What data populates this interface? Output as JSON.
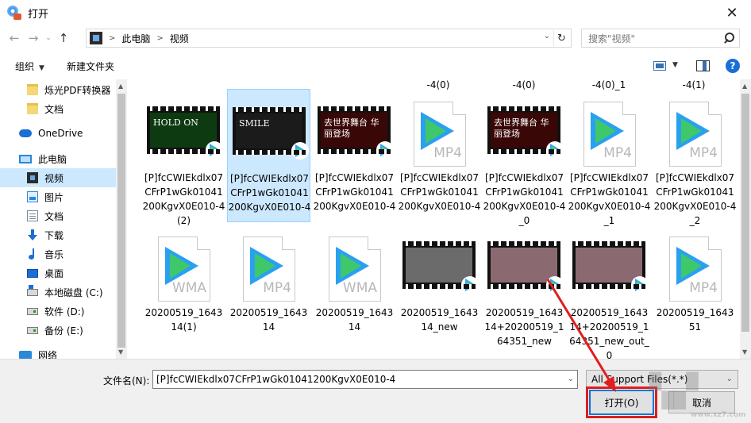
{
  "window": {
    "title": "打开",
    "close_label": "✕"
  },
  "address": {
    "crumbs": [
      "此电脑",
      "视频"
    ],
    "search_placeholder": "搜索\"视频\""
  },
  "toolbar": {
    "organize": "组织",
    "new_folder": "新建文件夹"
  },
  "nav": {
    "items": [
      {
        "label": "烁光PDF转换器",
        "icon": "folder-icon"
      },
      {
        "label": "文档",
        "icon": "folder-icon"
      },
      {
        "label": "OneDrive",
        "icon": "cloud-icon"
      },
      {
        "label": "此电脑",
        "icon": "computer-icon"
      },
      {
        "label": "视频",
        "icon": "video-icon",
        "selected": true
      },
      {
        "label": "图片",
        "icon": "pictures-icon"
      },
      {
        "label": "文档",
        "icon": "documents-icon"
      },
      {
        "label": "下载",
        "icon": "download-icon"
      },
      {
        "label": "音乐",
        "icon": "music-icon"
      },
      {
        "label": "桌面",
        "icon": "desktop-icon"
      },
      {
        "label": "本地磁盘 (C:)",
        "icon": "system-drive-icon"
      },
      {
        "label": "软件 (D:)",
        "icon": "drive-icon"
      },
      {
        "label": "备份 (E:)",
        "icon": "drive-icon"
      },
      {
        "label": "网络",
        "icon": "network-icon"
      }
    ]
  },
  "partial_row": [
    "-4(0)",
    "-4(0)",
    "-4(0)_1",
    "-4(1)"
  ],
  "files_row1": [
    {
      "name": "[P]fcCWIEkdlx07CFrP1wGk01041200KgvX0E010-4(2)",
      "type": "video",
      "frame_text": "HOLD ON",
      "frame_color": "#0e3a12"
    },
    {
      "name": "[P]fcCWIEkdlx07CFrP1wGk01041200KgvX0E010-4",
      "type": "video",
      "frame_text": "SMILE",
      "frame_color": "#1b1b1b",
      "selected": true
    },
    {
      "name": "[P]fcCWIEkdlx07CFrP1wGk01041200KgvX0E010-4",
      "type": "video",
      "frame_text": "去世界舞台 华丽登场",
      "frame_color": "#3a0707"
    },
    {
      "name": "[P]fcCWIEkdlx07CFrP1wGk01041200KgvX0E010-4",
      "type": "doc",
      "ext": "MP4"
    },
    {
      "name": "[P]fcCWIEkdlx07CFrP1wGk01041200KgvX0E010-4_0",
      "type": "video",
      "frame_text": "去世界舞台 华丽登场",
      "frame_color": "#3a0707"
    },
    {
      "name": "[P]fcCWIEkdlx07CFrP1wGk01041200KgvX0E010-4_1",
      "type": "doc",
      "ext": "MP4"
    },
    {
      "name": "[P]fcCWIEkdlx07CFrP1wGk01041200KgvX0E010-4_2",
      "type": "doc",
      "ext": "MP4"
    }
  ],
  "files_row2": [
    {
      "name": "20200519_164314(1)",
      "type": "doc",
      "ext": "WMA"
    },
    {
      "name": "20200519_164314",
      "type": "doc",
      "ext": "MP4"
    },
    {
      "name": "20200519_164314",
      "type": "doc",
      "ext": "WMA"
    },
    {
      "name": "20200519_164314_new",
      "type": "video",
      "frame_text": "",
      "frame_color": "#6b6b6b"
    },
    {
      "name": "20200519_164314+20200519_164351_new",
      "type": "video",
      "frame_text": "",
      "frame_color": "#8a6a70"
    },
    {
      "name": "20200519_164314+20200519_164351_new_out_0",
      "type": "video",
      "frame_text": "",
      "frame_color": "#8a6a70"
    },
    {
      "name": "20200519_164351",
      "type": "doc",
      "ext": "MP4"
    }
  ],
  "bottom": {
    "filename_label": "文件名(N):",
    "filename_value": "[P]fcCWIEkdlx07CFrP1wGk01041200KgvX0E010-4",
    "filter_value": "All Support Files(*.*)",
    "open_label": "打开(O)",
    "cancel_label": "取消"
  },
  "colors": {
    "selection": "#cce8ff",
    "accent": "#0078d7",
    "annotation": "#e11d1d"
  }
}
